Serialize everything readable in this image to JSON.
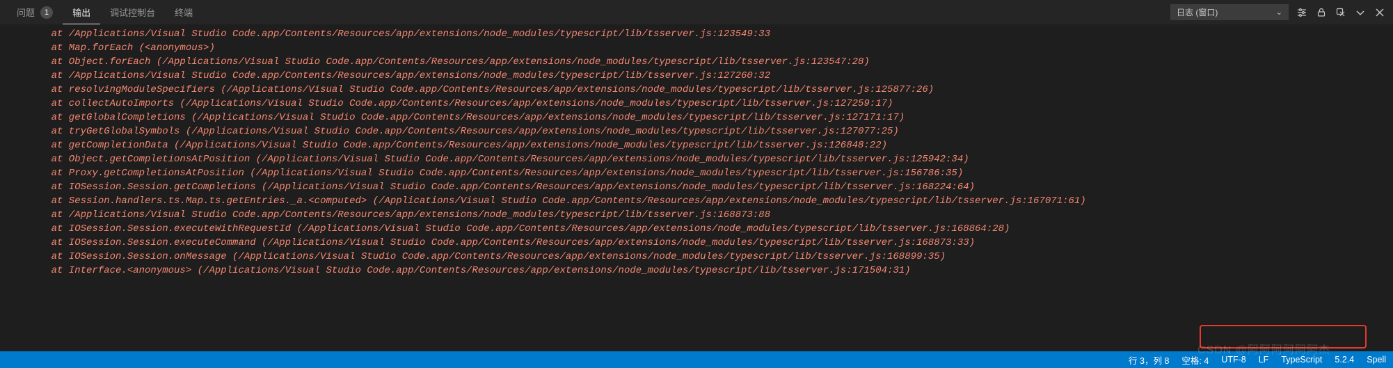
{
  "tabs": {
    "problems": {
      "label": "问题",
      "badge": "1"
    },
    "output": {
      "label": "输出"
    },
    "debug": {
      "label": "调试控制台"
    },
    "terminal": {
      "label": "终端"
    }
  },
  "tools": {
    "log_selector": "日志 (窗口)"
  },
  "log": {
    "lines": [
      "at /Applications/Visual Studio Code.app/Contents/Resources/app/extensions/node_modules/typescript/lib/tsserver.js:123549:33",
      "at Map.forEach (<anonymous>)",
      "at Object.forEach (/Applications/Visual Studio Code.app/Contents/Resources/app/extensions/node_modules/typescript/lib/tsserver.js:123547:28)",
      "at /Applications/Visual Studio Code.app/Contents/Resources/app/extensions/node_modules/typescript/lib/tsserver.js:127260:32",
      "at resolvingModuleSpecifiers (/Applications/Visual Studio Code.app/Contents/Resources/app/extensions/node_modules/typescript/lib/tsserver.js:125877:26)",
      "at collectAutoImports (/Applications/Visual Studio Code.app/Contents/Resources/app/extensions/node_modules/typescript/lib/tsserver.js:127259:17)",
      "at getGlobalCompletions (/Applications/Visual Studio Code.app/Contents/Resources/app/extensions/node_modules/typescript/lib/tsserver.js:127171:17)",
      "at tryGetGlobalSymbols (/Applications/Visual Studio Code.app/Contents/Resources/app/extensions/node_modules/typescript/lib/tsserver.js:127077:25)",
      "at getCompletionData (/Applications/Visual Studio Code.app/Contents/Resources/app/extensions/node_modules/typescript/lib/tsserver.js:126848:22)",
      "at Object.getCompletionsAtPosition (/Applications/Visual Studio Code.app/Contents/Resources/app/extensions/node_modules/typescript/lib/tsserver.js:125942:34)",
      "at Proxy.getCompletionsAtPosition (/Applications/Visual Studio Code.app/Contents/Resources/app/extensions/node_modules/typescript/lib/tsserver.js:156786:35)",
      "at IOSession.Session.getCompletions (/Applications/Visual Studio Code.app/Contents/Resources/app/extensions/node_modules/typescript/lib/tsserver.js:168224:64)",
      "at Session.handlers.ts.Map.ts.getEntries._a.<computed> (/Applications/Visual Studio Code.app/Contents/Resources/app/extensions/node_modules/typescript/lib/tsserver.js:167071:61)",
      "at /Applications/Visual Studio Code.app/Contents/Resources/app/extensions/node_modules/typescript/lib/tsserver.js:168873:88",
      "at IOSession.Session.executeWithRequestId (/Applications/Visual Studio Code.app/Contents/Resources/app/extensions/node_modules/typescript/lib/tsserver.js:168864:28)",
      "at IOSession.Session.executeCommand (/Applications/Visual Studio Code.app/Contents/Resources/app/extensions/node_modules/typescript/lib/tsserver.js:168873:33)",
      "at IOSession.Session.onMessage (/Applications/Visual Studio Code.app/Contents/Resources/app/extensions/node_modules/typescript/lib/tsserver.js:168899:35)",
      "at Interface.<anonymous> (/Applications/Visual Studio Code.app/Contents/Resources/app/extensions/node_modules/typescript/lib/tsserver.js:171504:31)"
    ]
  },
  "status": {
    "line_col": "行 3，列 8",
    "spaces": "空格: 4",
    "encoding": "UTF-8",
    "eol": "LF",
    "language": "TypeScript",
    "version": "5.2.4",
    "spell": "Spell"
  },
  "watermark": "CSDN @阿阿阿阿阿阿杰"
}
